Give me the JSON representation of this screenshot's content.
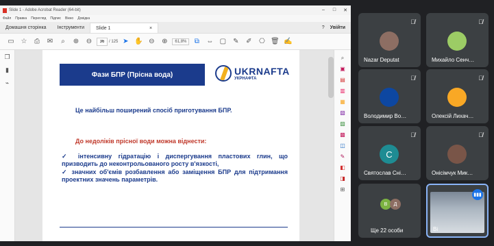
{
  "window": {
    "title": "Slide 1 - Adobe Acrobat Reader (64-bit)",
    "menus": [
      "Файл",
      "Правка",
      "Перегляд",
      "Підпис",
      "Вікно",
      "Довідка"
    ],
    "tabs": {
      "home": "Домашня сторінка",
      "tools": "Інструменти",
      "doc": "Slide 1"
    },
    "signin": "Увійти"
  },
  "toolbar": {
    "page_current": "36",
    "page_total": "/ 125",
    "zoom": "61,8%"
  },
  "slide": {
    "title": "Фази БПР (Прісна вода)",
    "logo_big": "UKRNAFTA",
    "logo_small": "УКРНАФТА",
    "line1": "Це найбільш поширений спосіб приготування БПР.",
    "line2": "До недоліків прісної води можна віднести:",
    "bullet1": "✓   інтенсивну гідратацію і диспергування пластових глин, що призводить до неконтрольованого росту в'язкості,",
    "bullet2": "✓   значних об'ємів розбавлення або заміщення БПР для підтримання проектних значень параметрів."
  },
  "participants": [
    {
      "name": "Nazar Deputat",
      "color": "#8d6e63"
    },
    {
      "name": "Михайло Сенч…",
      "color": "#9ccc65"
    },
    {
      "name": "Володимир Во…",
      "color": "#0d47a1"
    },
    {
      "name": "Олексій Лихач…",
      "color": "#f9a825"
    },
    {
      "name": "Святослав Сні…",
      "letter": "С",
      "color": "#1e8c93"
    },
    {
      "name": "Онісімчук Мик…",
      "color": "#795548"
    },
    {
      "name": "Ще 22 особи",
      "letters": [
        "В",
        "Д"
      ],
      "colors": [
        "#7cb342",
        "#8d6e63"
      ]
    },
    {
      "name": "Ві"
    }
  ],
  "colors": {
    "accent": "#1b3b8c",
    "warning": "#c0392b",
    "meet_bg": "#202124",
    "tile_bg": "#3c4043"
  }
}
